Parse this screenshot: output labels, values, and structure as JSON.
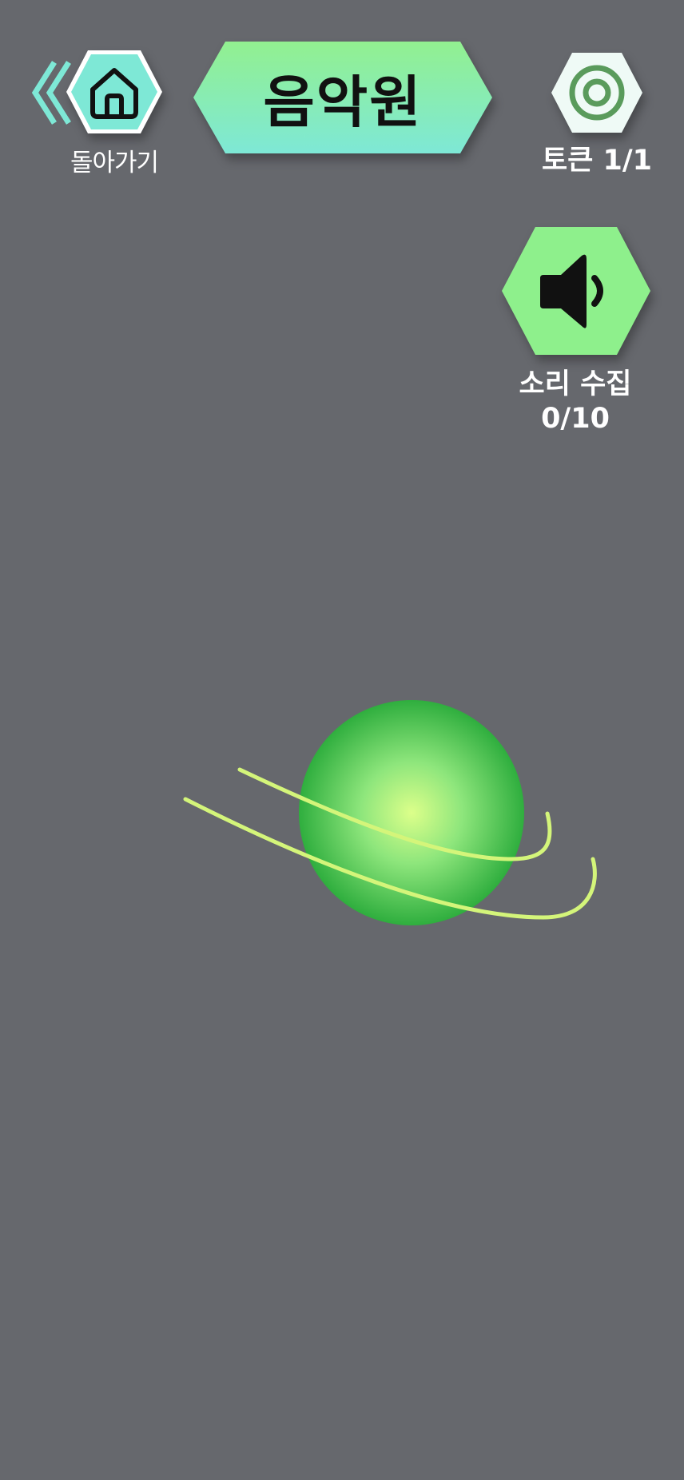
{
  "header": {
    "title": "음악원",
    "back_label": "돌아가기",
    "token_label": "토큰 1/1"
  },
  "sound": {
    "label_line1": "소리 수집",
    "label_line2": "0/10",
    "collected": 0,
    "total": 10
  },
  "tokens": {
    "current": 1,
    "total": 1
  },
  "icons": {
    "back": "double-chevron-left-icon",
    "home": "home-icon",
    "token": "target-ring-icon",
    "sound": "speaker-icon",
    "planet": "planet-icon"
  },
  "colors": {
    "background": "#66686d",
    "accent_teal": "#7ee8d6",
    "accent_green": "#8ef08c",
    "planet_core": "#dcff8a",
    "planet_edge": "#2fae3e",
    "ring": "#d4f57a"
  }
}
